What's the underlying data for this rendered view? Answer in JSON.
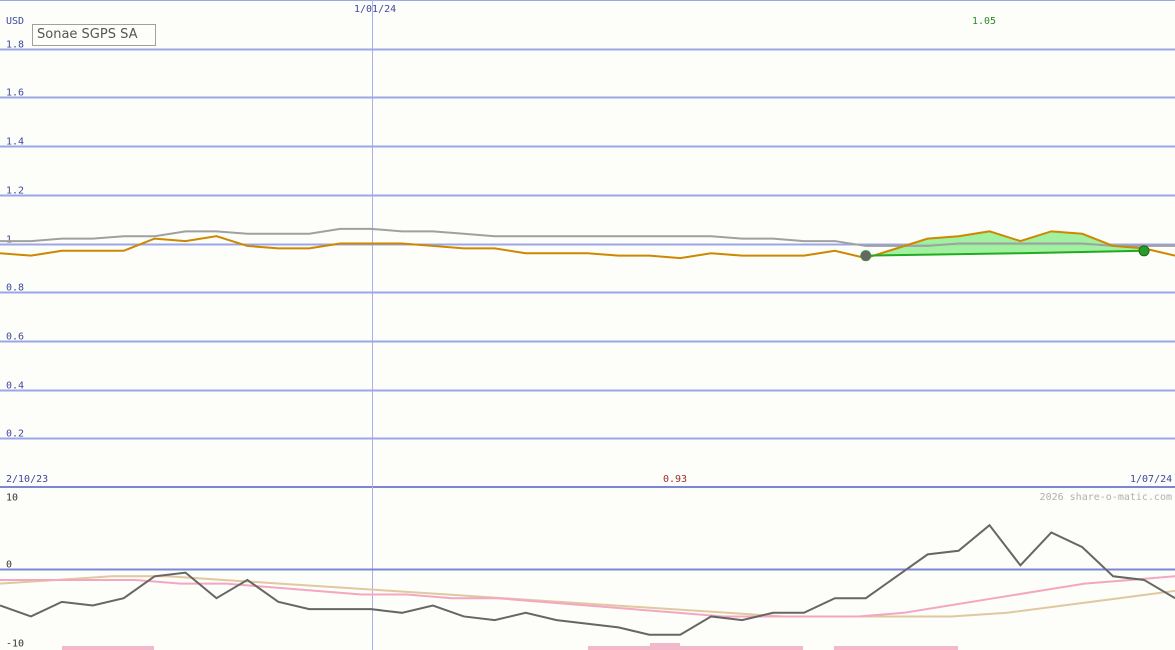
{
  "chart_data": [
    {
      "type": "line",
      "title": "Sonae SGPS SA",
      "ylabel": "USD",
      "ylim": [
        0,
        2.0
      ],
      "yticks": [
        "1.8",
        "1.6",
        "1.4",
        "1.2",
        "1",
        "0.8",
        "0.6",
        "0.4",
        "0.2"
      ],
      "ytick_values": [
        1.8,
        1.6,
        1.4,
        1.2,
        1.0,
        0.8,
        0.6,
        0.4,
        0.2
      ],
      "x_start_label": "2/10/23",
      "x_end_label": "1/07/24",
      "x_mid_label": "1/01/24",
      "high_label": "1.05",
      "low_label": "0.93",
      "series": [
        {
          "color": "#cc8800",
          "values": [
            0.96,
            0.95,
            0.97,
            0.97,
            0.97,
            1.02,
            1.01,
            1.03,
            0.99,
            0.98,
            0.98,
            1.0,
            1.0,
            1.0,
            0.99,
            0.98,
            0.98,
            0.96,
            0.96,
            0.96,
            0.95,
            0.95,
            0.94,
            0.96,
            0.95,
            0.95,
            0.95,
            0.97,
            0.94,
            0.98,
            1.02,
            1.03,
            1.05,
            1.01,
            1.05,
            1.04,
            0.99,
            0.98,
            0.95
          ]
        },
        {
          "color": "#a0a0a0",
          "values": [
            1.01,
            1.01,
            1.02,
            1.02,
            1.03,
            1.03,
            1.05,
            1.05,
            1.04,
            1.04,
            1.04,
            1.06,
            1.06,
            1.05,
            1.05,
            1.04,
            1.03,
            1.03,
            1.03,
            1.03,
            1.03,
            1.03,
            1.03,
            1.03,
            1.02,
            1.02,
            1.01,
            1.01,
            0.99,
            0.99,
            0.99,
            1.0,
            1.0,
            1.0,
            1.0,
            1.0,
            0.99,
            0.99,
            0.99
          ]
        },
        {
          "color": "#22aa22",
          "values": [
            0.95,
            0.96,
            0.97
          ]
        }
      ]
    },
    {
      "type": "line",
      "ylim": [
        -10,
        10
      ],
      "yticks": [
        "10",
        "0",
        "-10"
      ],
      "ytick_values": [
        10,
        0,
        -10
      ],
      "watermark": "2026 share-o-matic.com",
      "series": [
        {
          "color": "#666666",
          "values": [
            -5,
            -6.5,
            -4.5,
            -5,
            -4,
            -1,
            -0.5,
            -4,
            -1.5,
            -4.5,
            -5.5,
            -5.5,
            -5.5,
            -6,
            -5,
            -6.5,
            -7,
            -6,
            -7,
            -7.5,
            -8,
            -9,
            -9,
            -6.5,
            -7,
            -6,
            -6,
            -4,
            -4,
            -1,
            2,
            2.5,
            6,
            0.5,
            5,
            3,
            -1,
            -1.5,
            -4
          ]
        },
        {
          "color": "#f4a7c0",
          "values": [
            -1.5,
            -1.5,
            -1.5,
            -1.5,
            -2,
            -2,
            -2.5,
            -3,
            -3.5,
            -3.5,
            -4,
            -4,
            -4.5,
            -5,
            -5.5,
            -6,
            -6.5,
            -6.5,
            -6.5,
            -6.5,
            -6,
            -5,
            -4,
            -3,
            -2,
            -1.5,
            -1
          ]
        },
        {
          "color": "#e0c8a0",
          "values": [
            -2,
            -1.5,
            -1,
            -1,
            -1.5,
            -2,
            -2.5,
            -3,
            -3.5,
            -4,
            -4.5,
            -5,
            -5.5,
            -6,
            -6.5,
            -6.5,
            -6.5,
            -6.5,
            -6,
            -5,
            -4,
            -3
          ]
        }
      ]
    }
  ]
}
